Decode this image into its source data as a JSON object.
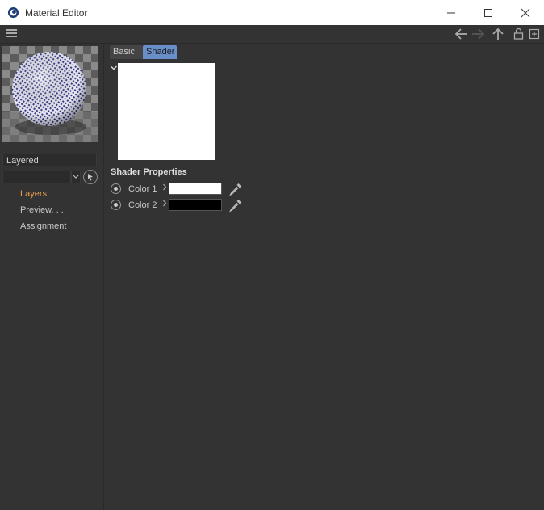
{
  "window": {
    "title": "Material Editor",
    "icon": "cinema4d-app-icon"
  },
  "material": {
    "name": "Layered"
  },
  "channels": [
    {
      "label": "Layers",
      "active": true
    },
    {
      "label": "Preview. . .",
      "active": false
    },
    {
      "label": "Assignment",
      "active": false
    }
  ],
  "tabs": {
    "basic": "Basic",
    "shader": "Shader"
  },
  "shader_properties": {
    "heading": "Shader Properties",
    "colors": [
      {
        "label": "Color 1",
        "value": "#ffffff"
      },
      {
        "label": "Color 2",
        "value": "#000000"
      }
    ]
  },
  "colors": {
    "active_channel": "#f0a050",
    "selected_tab": "#6a8fc8",
    "background": "#333333"
  }
}
